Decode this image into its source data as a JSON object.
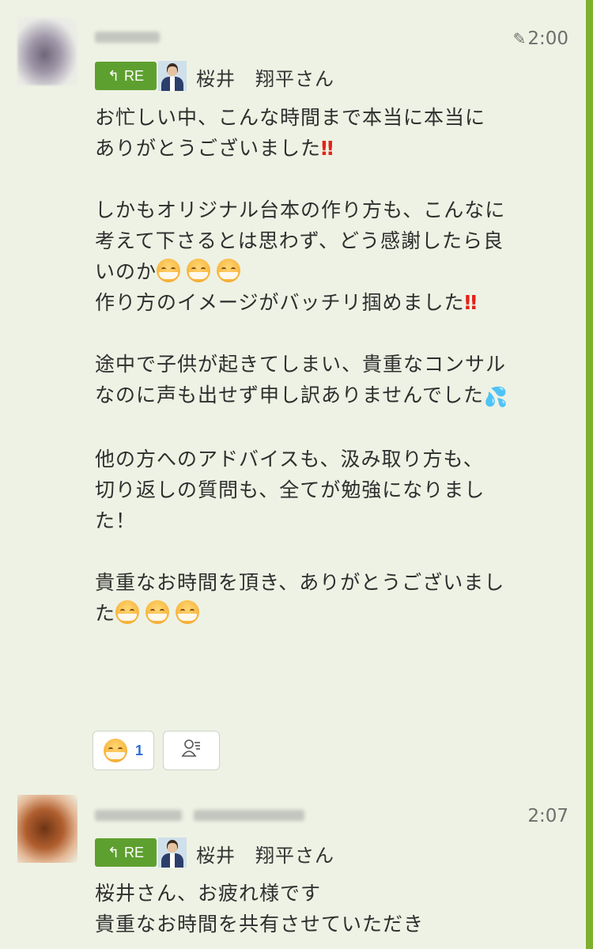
{
  "messages": [
    {
      "time": "2:00",
      "reply": {
        "badge": "RE",
        "to": "桜井　翔平さん"
      },
      "lines": [
        "お忙しい中、こんな時間まで本当に本当に",
        "ありがとうございました",
        "",
        "しかもオリジナル台本の作り方も、こんなに",
        "考えて下さるとは思わず、どう感謝したら良",
        "いのか",
        "作り方のイメージがバッチリ掴めました",
        "",
        "途中で子供が起きてしまい、貴重なコンサル",
        "なのに声も出せず申し訳ありませんでした",
        "",
        "他の方へのアドバイスも、汲み取り方も、",
        "切り返しの質問も、全てが勉強になりまし",
        "た！",
        "",
        "貴重なお時間を頂き、ありがとうございまし",
        "た"
      ],
      "reaction_count": "1"
    },
    {
      "time": "2:07",
      "reply": {
        "badge": "RE",
        "to": "桜井　翔平さん"
      },
      "lines": [
        "桜井さん、お疲れ様です",
        "貴重なお時間を共有させていただき"
      ]
    }
  ],
  "colors": {
    "background": "#eef2e4",
    "accent": "#5ea02f",
    "right_bar": "#7db02c",
    "exclamation": "#e2231a",
    "reaction_count": "#2e6bd6"
  },
  "icons": {
    "edited": "pencil-icon",
    "reply": "reply-arrow-icon",
    "reaction": "sleepy-face-emoji",
    "sweat": "sweat-drops-emoji",
    "read_users": "user-list-icon",
    "double_exclamation": "double-exclamation-emoji"
  }
}
